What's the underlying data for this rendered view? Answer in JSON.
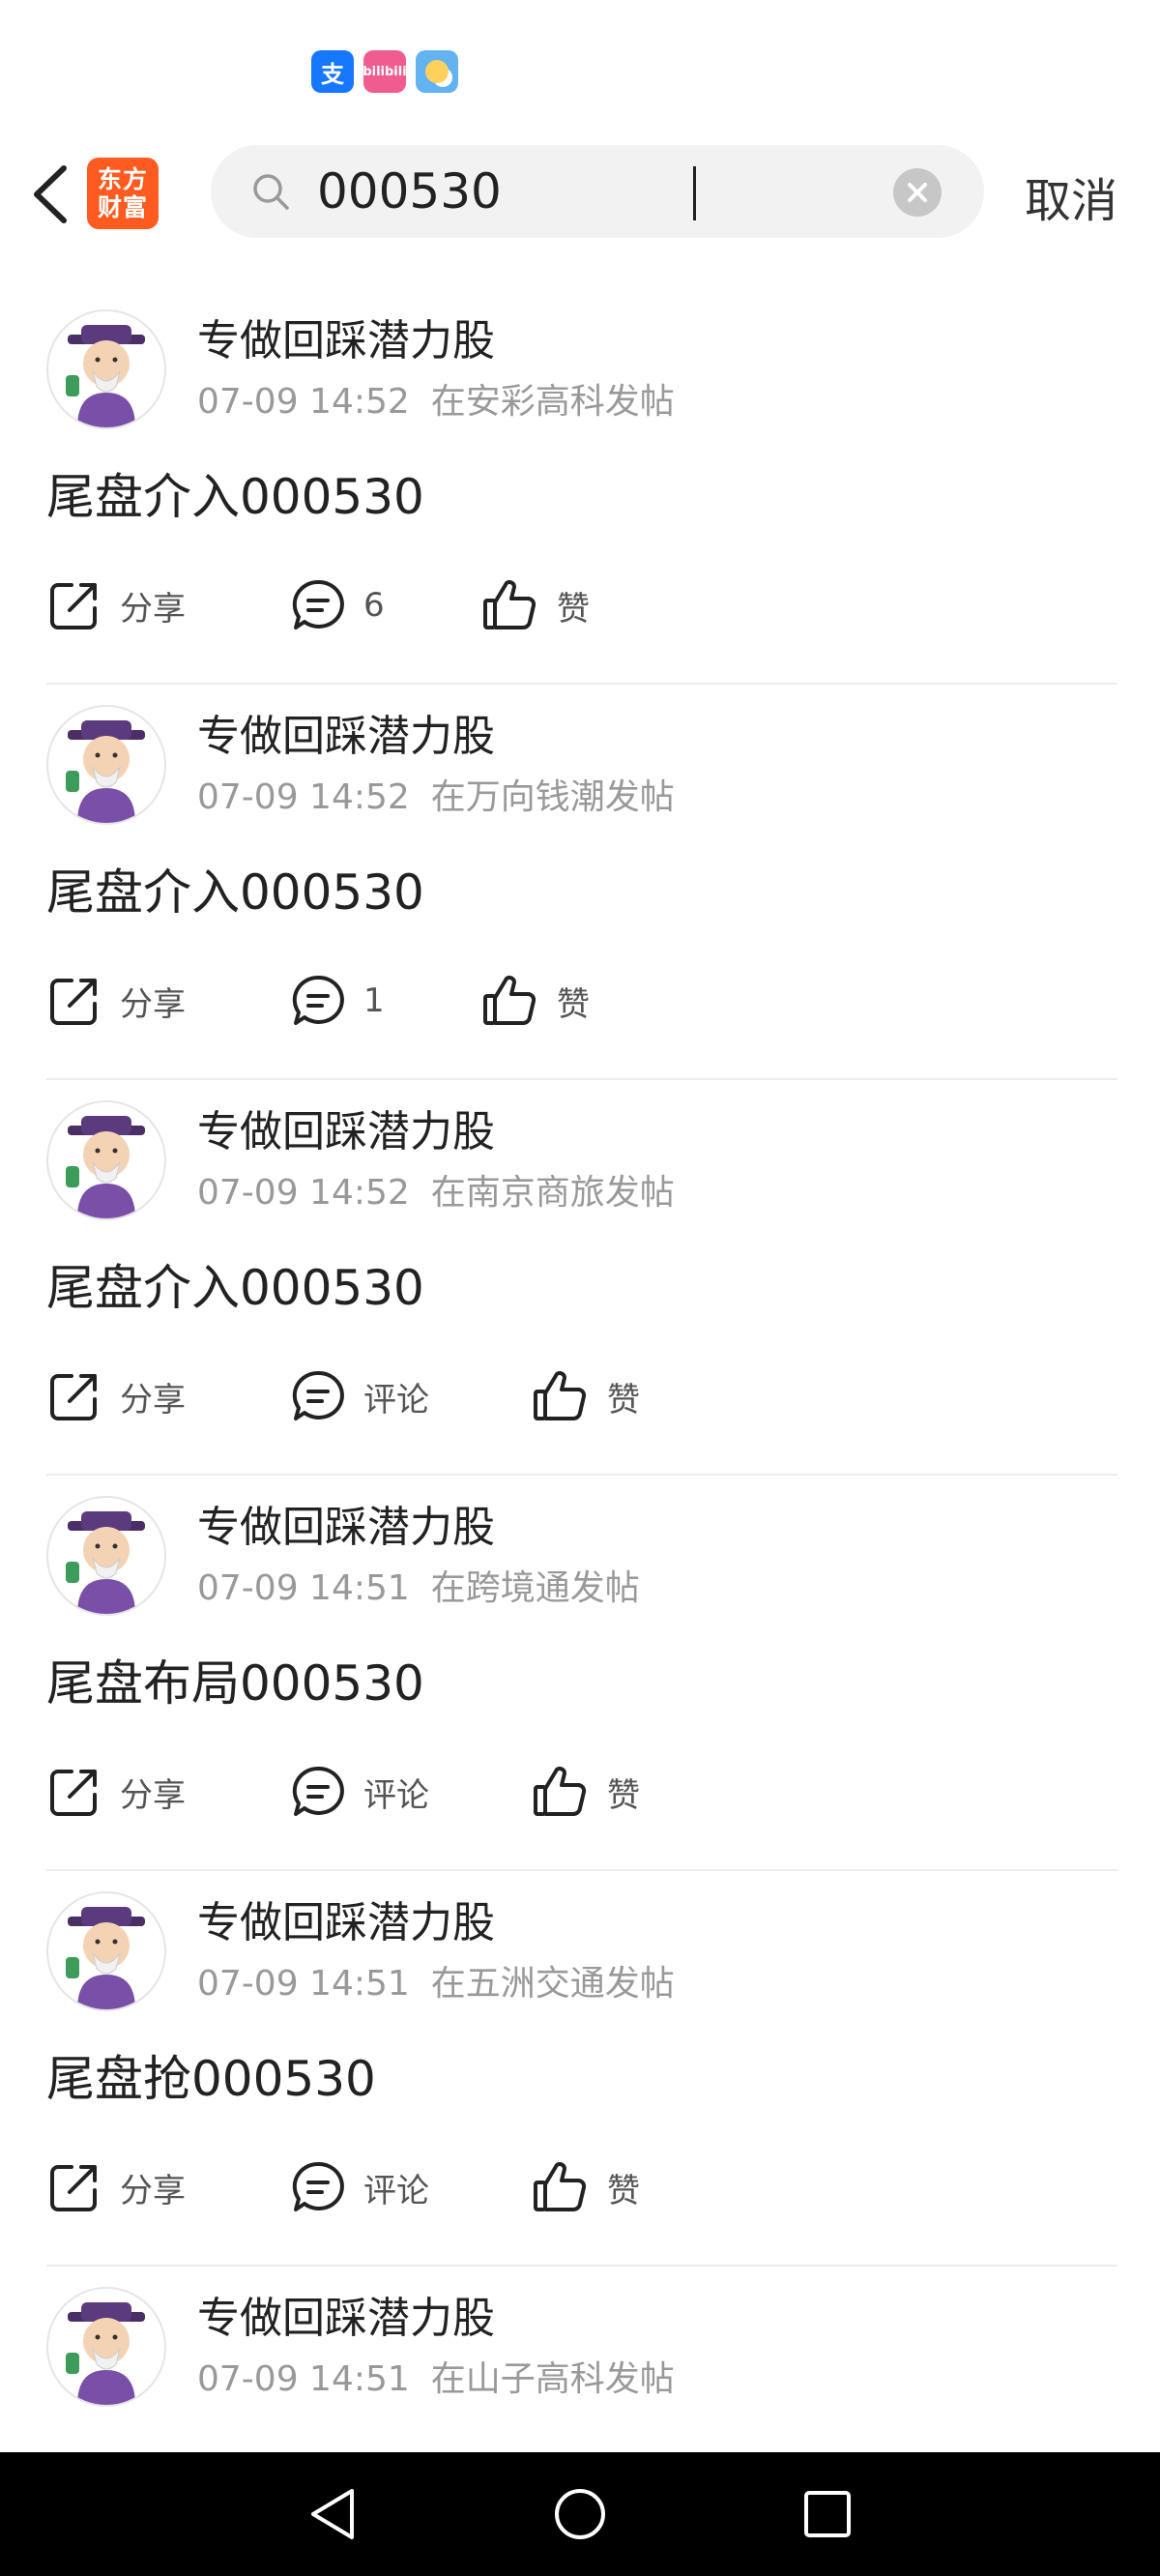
{
  "status_bar": {
    "icons": [
      {
        "name": "alipay-icon",
        "glyph": "支"
      },
      {
        "name": "bilibili-icon",
        "glyph": "bilibili"
      },
      {
        "name": "weather-icon",
        "glyph": ""
      }
    ]
  },
  "header": {
    "app_logo_line1": "东方",
    "app_logo_line2": "财富",
    "search_value": "000530",
    "cancel_label": "取消",
    "accent_color": "#ff5a1f"
  },
  "posts": [
    {
      "author": "专做回踩潜力股",
      "time": "07-09 14:52",
      "location": "在安彩高科发帖",
      "content": "尾盘介入000530",
      "share": "分享",
      "comment": "6",
      "like": "赞"
    },
    {
      "author": "专做回踩潜力股",
      "time": "07-09 14:52",
      "location": "在万向钱潮发帖",
      "content": "尾盘介入000530",
      "share": "分享",
      "comment": "1",
      "like": "赞"
    },
    {
      "author": "专做回踩潜力股",
      "time": "07-09 14:52",
      "location": "在南京商旅发帖",
      "content": "尾盘介入000530",
      "share": "分享",
      "comment": "评论",
      "like": "赞"
    },
    {
      "author": "专做回踩潜力股",
      "time": "07-09 14:51",
      "location": "在跨境通发帖",
      "content": "尾盘布局000530",
      "share": "分享",
      "comment": "评论",
      "like": "赞"
    },
    {
      "author": "专做回踩潜力股",
      "time": "07-09 14:51",
      "location": "在五洲交通发帖",
      "content": "尾盘抢000530",
      "share": "分享",
      "comment": "评论",
      "like": "赞"
    },
    {
      "author": "专做回踩潜力股",
      "time": "07-09 14:51",
      "location": "在山子高科发帖",
      "content": "",
      "share": "",
      "comment": "",
      "like": ""
    }
  ]
}
